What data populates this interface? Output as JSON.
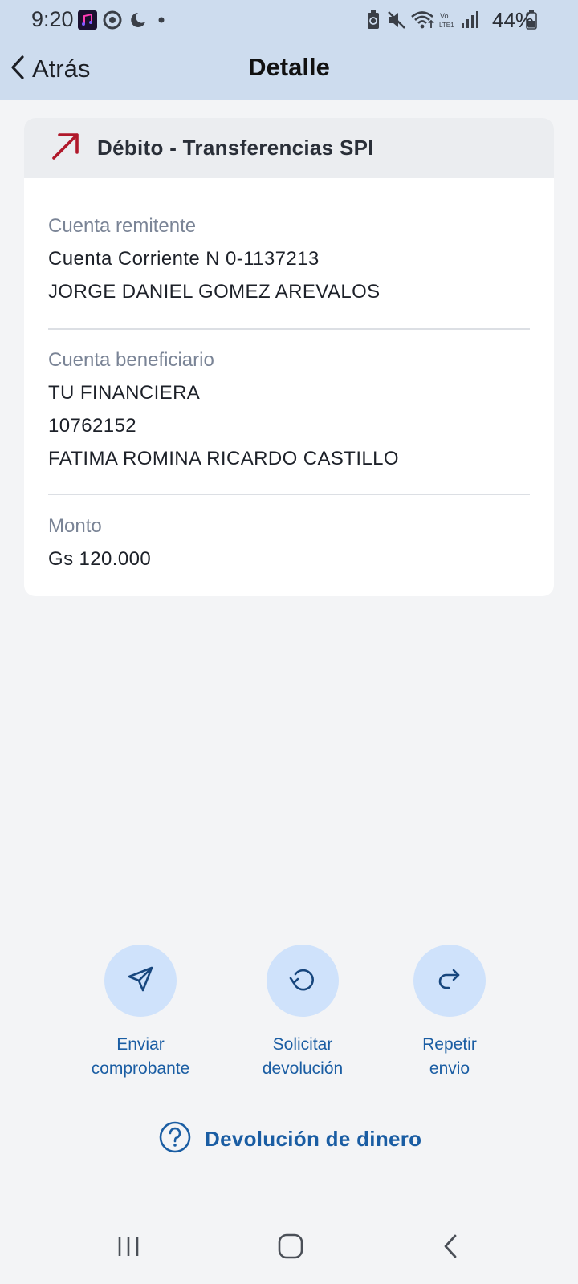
{
  "status_bar": {
    "time": "9:20",
    "battery": "44%",
    "icons": [
      "music-app-icon",
      "chrome-icon",
      "night-mode-icon",
      "dot-icon",
      "battery-saver-icon",
      "mute-icon",
      "wifi-icon",
      "volte-icon",
      "signal-icon",
      "battery-icon"
    ]
  },
  "header": {
    "back_label": "Atrás",
    "title": "Detalle"
  },
  "card": {
    "title": "Débito - Transferencias SPI",
    "direction_icon": "arrow-up-right-icon",
    "direction_color": "#b0182a",
    "sender": {
      "label": "Cuenta remitente",
      "account": "Cuenta Corriente N 0-1137213",
      "name": "JORGE DANIEL GOMEZ AREVALOS"
    },
    "beneficiary": {
      "label": "Cuenta beneficiario",
      "bank": "TU FINANCIERA",
      "account": "10762152",
      "name": "FATIMA ROMINA RICARDO CASTILLO"
    },
    "amount": {
      "label": "Monto",
      "value": "Gs 120.000"
    }
  },
  "actions": [
    {
      "label": "Enviar\ncomprobante",
      "icon": "send-icon"
    },
    {
      "label": "Solicitar\ndevolución",
      "icon": "refund-icon"
    },
    {
      "label": "Repetir\nenvio",
      "icon": "repeat-icon"
    }
  ],
  "help_link": {
    "label": "Devolución de dinero",
    "icon": "question-circle-icon"
  },
  "colors": {
    "accent": "#1a5da3",
    "header_bg": "#cddcee",
    "action_bg": "#cfe2fb"
  }
}
